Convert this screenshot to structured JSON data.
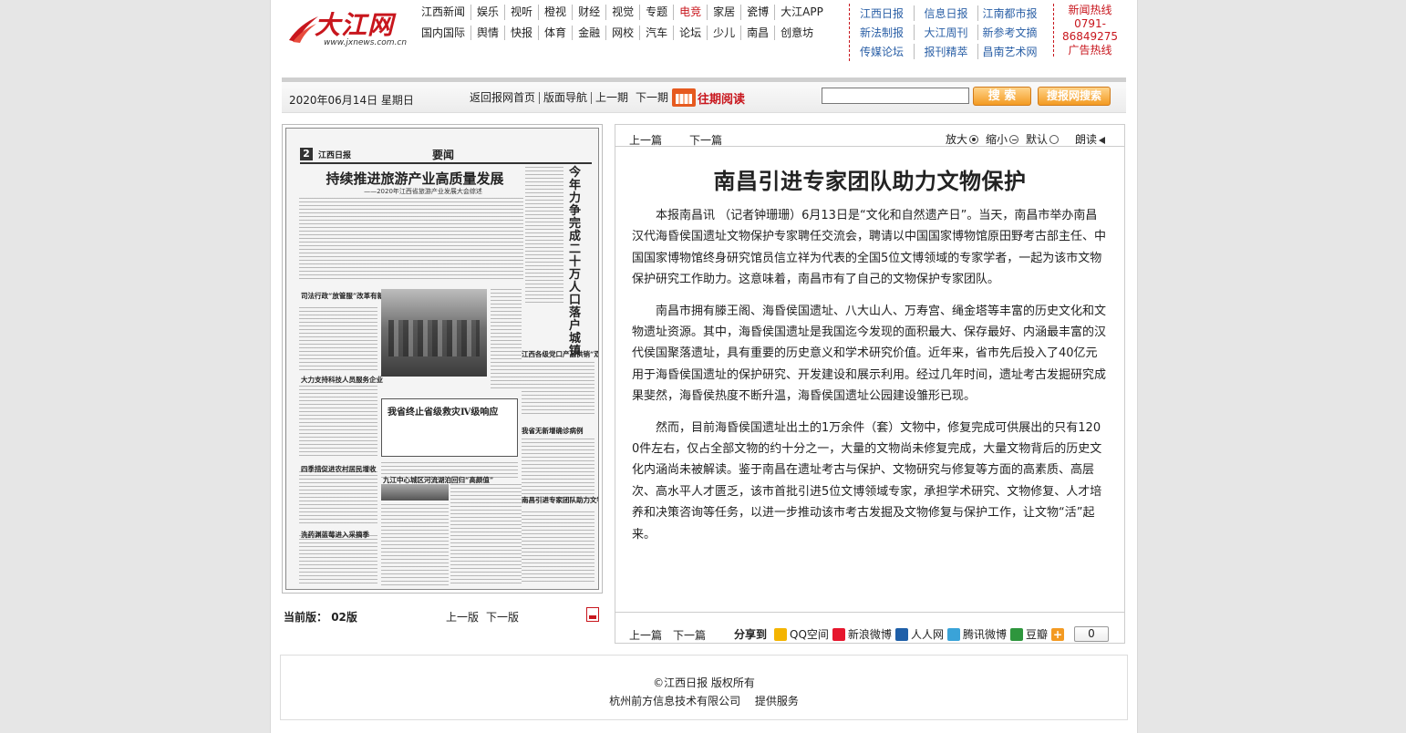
{
  "site": {
    "logo_text": "大江网",
    "logo_url": "www.jxnews.com.cn"
  },
  "nav": {
    "row1": [
      {
        "label": "江西新闻",
        "hot": false
      },
      {
        "label": "娱乐",
        "hot": false
      },
      {
        "label": "视听",
        "hot": false
      },
      {
        "label": "橙视",
        "hot": false
      },
      {
        "label": "财经",
        "hot": false
      },
      {
        "label": "视觉",
        "hot": false
      },
      {
        "label": "专题",
        "hot": false
      },
      {
        "label": "电竞",
        "hot": true
      },
      {
        "label": "家居",
        "hot": false
      },
      {
        "label": "瓷博",
        "hot": false
      },
      {
        "label": "大江APP",
        "hot": false
      }
    ],
    "row2": [
      {
        "label": "国内国际",
        "hot": false
      },
      {
        "label": "舆情",
        "hot": false
      },
      {
        "label": "快报",
        "hot": false
      },
      {
        "label": "体育",
        "hot": false
      },
      {
        "label": "金融",
        "hot": false
      },
      {
        "label": "网校",
        "hot": false
      },
      {
        "label": "汽车",
        "hot": false
      },
      {
        "label": "论坛",
        "hot": false
      },
      {
        "label": "少儿",
        "hot": false
      },
      {
        "label": "南昌",
        "hot": false
      },
      {
        "label": "创意坊",
        "hot": false
      }
    ]
  },
  "papers": [
    [
      "江西日报",
      "信息日报",
      "江南都市报"
    ],
    [
      "新法制报",
      "大江周刊",
      "新参考文摘"
    ],
    [
      "传媒论坛",
      "报刊精萃",
      "昌南艺术网"
    ]
  ],
  "hotline": {
    "line1": "新闻热线",
    "line2": "0791-",
    "line3": "86849275",
    "line4": "广告热线"
  },
  "datebar": {
    "date": "2020年06月14日 星期日",
    "links": [
      "返回报网首页",
      "版面导航",
      "上一期",
      "下一期"
    ],
    "archive": "往期阅读",
    "search_button": "搜 索",
    "search_paper_button": "搜报网搜索"
  },
  "thumb": {
    "page_num": "2",
    "brand": "江西日报",
    "section": "要闻",
    "title": "持续推进旅游产业高质量发展",
    "subtitle": "——2020年江西省旅游产业发展大会综述",
    "vertical_title": "今年力争完成二十万人口落户城镇",
    "headlines": [
      "司法行政“放管服”改革有新动作",
      "大力支持科技人员服务企业",
      "四季措促进农村居民增收",
      "洗药渊蓝莓进入采摘季",
      "江西各级党口产品供销“双线”对接",
      "我省无新增确诊病例",
      "南昌引进专家团队助力文物保护",
      "九江中心城区河流湖泊回归“高颜值”"
    ],
    "box_title": "我省终止省级救灾Ⅳ级响应"
  },
  "thumb_footer": {
    "current_label": "当前版：",
    "current_value": "02版",
    "prev": "上一版",
    "next": "下一版"
  },
  "article": {
    "prev": "上一篇",
    "next": "下一篇",
    "zoom_in": "放大",
    "zoom_out": "缩小",
    "default": "默认",
    "read_aloud": "朗读",
    "title": "南昌引进专家团队助力文物保护",
    "paragraphs": [
      "本报南昌讯 （记者钟珊珊）6月13日是“文化和自然遗产日”。当天，南昌市举办南昌汉代海昏侯国遗址文物保护专家聘任交流会，聘请以中国国家博物馆原田野考古部主任、中国国家博物馆终身研究馆员信立祥为代表的全国5位文博领域的专家学者，一起为该市文物保护研究工作助力。这意味着，南昌市有了自己的文物保护专家团队。",
      "南昌市拥有滕王阁、海昏侯国遗址、八大山人、万寿宫、绳金塔等丰富的历史文化和文物遗址资源。其中，海昏侯国遗址是我国迄今发现的面积最大、保存最好、内涵最丰富的汉代侯国聚落遗址，具有重要的历史意义和学术研究价值。近年来，省市先后投入了40亿元用于海昏侯国遗址的保护研究、开发建设和展示利用。经过几年时间，遗址考古发掘研究成果斐然，海昏侯热度不断升温，海昏侯国遗址公园建设雏形已现。",
      "然而，目前海昏侯国遗址出土的1万余件（套）文物中，修复完成可供展出的只有1200件左右，仅占全部文物的约十分之一，大量的文物尚未修复完成，大量文物背后的历史文化内涵尚未被解读。鉴于南昌在遗址考古与保护、文物研究与修复等方面的高素质、高层次、高水平人才匮乏，该市首批引进5位文博领域专家，承担学术研究、文物修复、人才培养和决策咨询等任务，以进一步推动该市考古发掘及文物修复与保护工作，让文物“活”起来。"
    ],
    "bottom_prev": "上一篇",
    "bottom_next": "下一篇",
    "share_label": "分享到",
    "share_items": [
      {
        "label": "QQ空间",
        "color": "#f4b400"
      },
      {
        "label": "新浪微博",
        "color": "#e6162d"
      },
      {
        "label": "人人网",
        "color": "#1f5fa8"
      },
      {
        "label": "腾讯微博",
        "color": "#3aa3d8"
      },
      {
        "label": "豆瓣",
        "color": "#2e963d"
      }
    ],
    "share_count": "0"
  },
  "footer": {
    "line1": "©江西日报 版权所有",
    "line2": "杭州前方信息技术有限公司 　提供服务"
  }
}
